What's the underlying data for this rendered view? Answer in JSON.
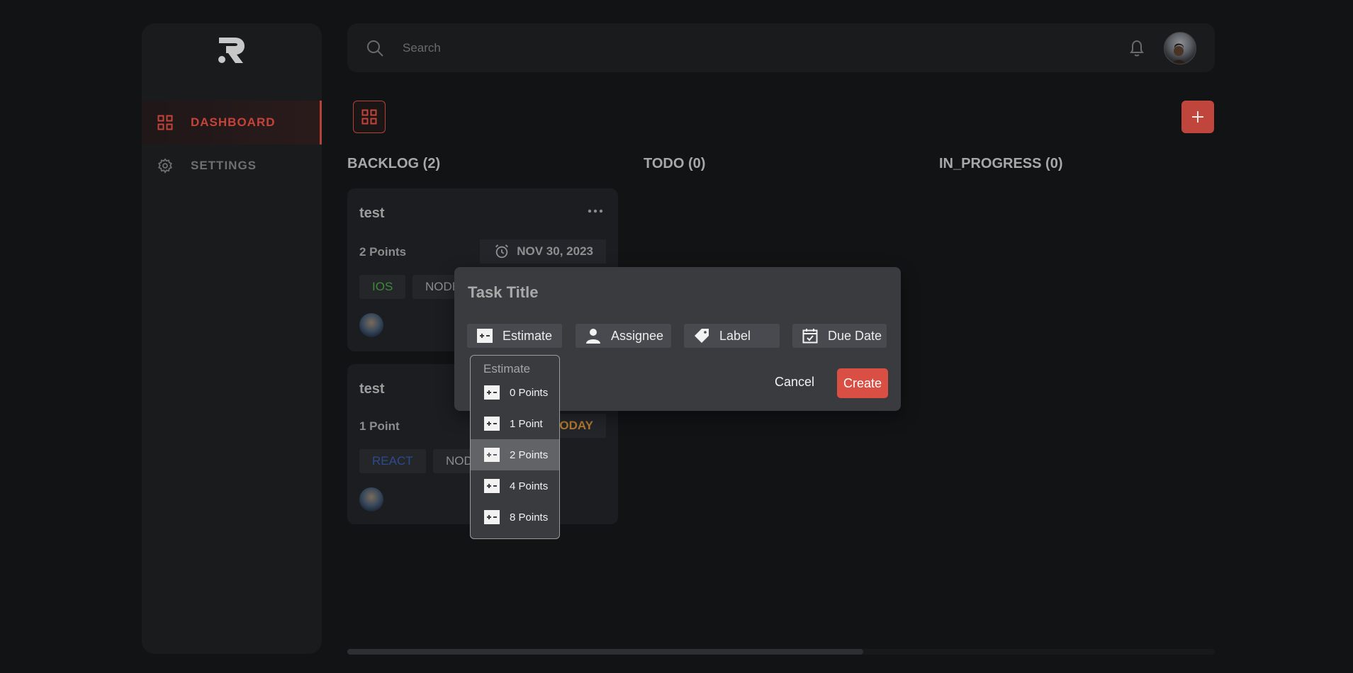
{
  "sidebar": {
    "items": [
      {
        "label": "DASHBOARD",
        "icon": "grid-icon",
        "active": true
      },
      {
        "label": "SETTINGS",
        "icon": "gear-icon",
        "active": false
      }
    ]
  },
  "topbar": {
    "search_placeholder": "Search",
    "search_value": ""
  },
  "board": {
    "columns": [
      {
        "title": "BACKLOG (2)"
      },
      {
        "title": "TODO (0)"
      },
      {
        "title": "IN_PROGRESS (0)"
      }
    ],
    "cards": [
      {
        "title": "test",
        "points": "2 Points",
        "date": "NOV 30, 2023",
        "tags": [
          "IOS",
          "NODE"
        ]
      },
      {
        "title": "test",
        "points": "1 Point",
        "date": "TODAY",
        "tags": [
          "REACT",
          "NODE"
        ]
      }
    ]
  },
  "modal": {
    "title_placeholder": "Task Title",
    "props": [
      "Estimate",
      "Assignee",
      "Label",
      "Due Date"
    ],
    "cancel_label": "Cancel",
    "create_label": "Create"
  },
  "dropdown": {
    "header": "Estimate",
    "options": [
      "0 Points",
      "1 Point",
      "2 Points",
      "4 Points",
      "8 Points"
    ],
    "selected": "2 Points"
  },
  "colors": {
    "accent": "#c0463d",
    "background": "#121315",
    "panel": "#1a1b1d",
    "tag_ios": "#3f8a3a",
    "tag_react": "#2d4a8f",
    "date_today": "#b07a2f"
  }
}
